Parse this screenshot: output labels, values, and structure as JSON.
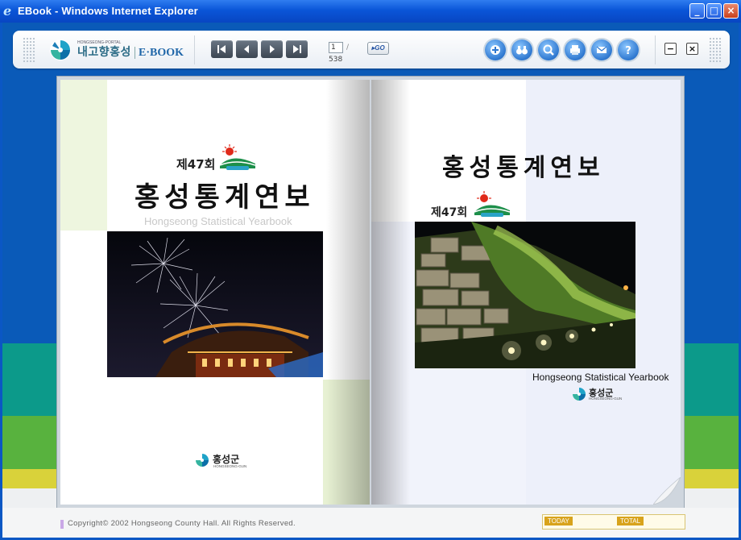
{
  "window": {
    "title": "EBook - Windows Internet Explorer",
    "controls": {
      "minimize": "_",
      "maximize": "□",
      "close": "×"
    }
  },
  "toolbar": {
    "logo": {
      "subtitle": "HONGSEONG-PORTAL",
      "name": "내고향홍성",
      "ebook": "E·BOOK"
    },
    "nav": [
      "first-page",
      "previous-page",
      "next-page",
      "last-page"
    ],
    "page": {
      "current": "1",
      "separator": "/",
      "total": "538",
      "go_label": "GO"
    },
    "tools": [
      "zoom-in-icon",
      "binoculars-icon",
      "magnifier-icon",
      "print-icon",
      "mail-icon",
      "help-icon"
    ],
    "help_glyph": "?",
    "window_minimize": "−",
    "window_close": "×"
  },
  "book": {
    "left_page": {
      "edition": "제47회",
      "title": "홍성통계연보",
      "subtitle": "Hongseong Statistical Yearbook",
      "publisher": "홍성군",
      "publisher_en": "HONGSEONG-GUN"
    },
    "right_page": {
      "title": "홍성통계연보",
      "edition": "제47회",
      "subtitle": "Hongseong Statistical Yearbook",
      "publisher": "홍성군",
      "publisher_en": "HONGSEONG-GUN"
    }
  },
  "footer": {
    "copyright": "Copyright© 2002 Hongseong County Hall. All Rights Reserved.",
    "today_label": "TODAY",
    "total_label": "TOTAL"
  },
  "colors": {
    "background_blue": "#0a5ab8",
    "band_teal": "#0c9a8a",
    "band_green": "#58b23e",
    "band_yellow": "#d9d23a",
    "accent_green": "#9acb3a"
  }
}
